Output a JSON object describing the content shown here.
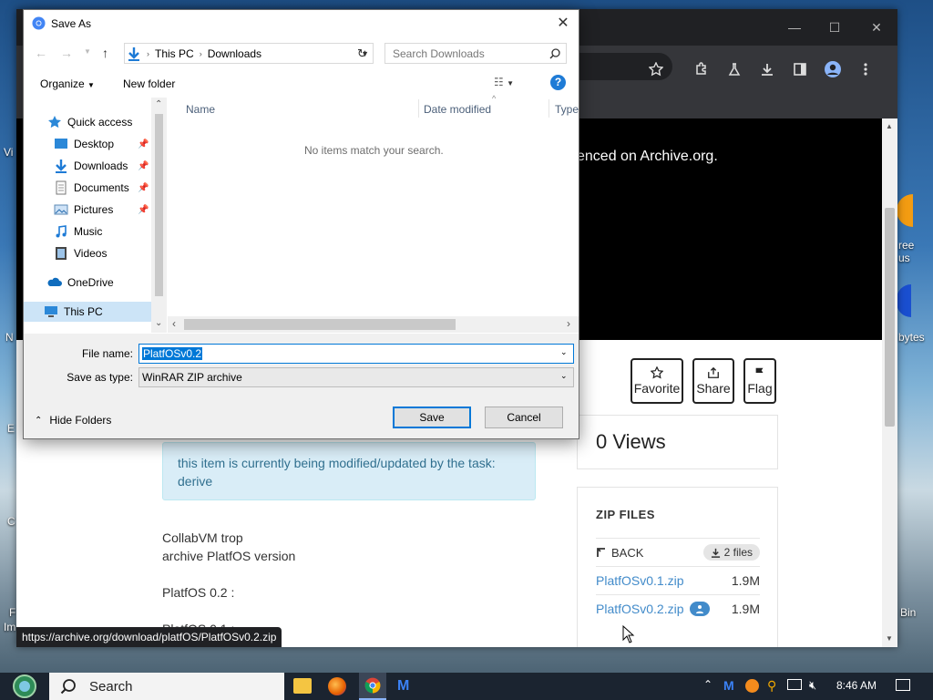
{
  "desktop": {
    "fragments": [
      "Vi",
      "ree",
      "us",
      "bytes",
      "N",
      "E",
      "C",
      "F",
      "Im",
      "Bin"
    ]
  },
  "browser": {
    "window_controls": {
      "minimize": "—",
      "maximize": "☐",
      "close": "✕"
    },
    "hero_text": "enced on Archive.org.",
    "actions": {
      "favorite": "Favorite",
      "share": "Share",
      "flag": "Flag"
    },
    "views": "0 Views",
    "notice": "this item is currently being modified/updated by the task: derive",
    "description": [
      "CollabVM trop",
      "archive PlatfOS version",
      "PlatfOS 0.2 :",
      "PlatfOS 0.1 :"
    ],
    "zip": {
      "title": "ZIP FILES",
      "back": "BACK",
      "files_badge": "2 files",
      "files": [
        {
          "name": "PlatfOSv0.1.zip",
          "size": "1.9M"
        },
        {
          "name": "PlatfOSv0.2.zip",
          "size": "1.9M"
        }
      ]
    },
    "status_url": "https://archive.org/download/platfOS/PlatfOSv0.2.zip"
  },
  "dialog": {
    "title": "Save As",
    "breadcrumb": [
      "This PC",
      "Downloads"
    ],
    "search_placeholder": "Search Downloads",
    "organize": "Organize",
    "new_folder": "New folder",
    "nav": {
      "quick_access": "Quick access",
      "desktop": "Desktop",
      "downloads": "Downloads",
      "documents": "Documents",
      "pictures": "Pictures",
      "music": "Music",
      "videos": "Videos",
      "onedrive": "OneDrive",
      "this_pc": "This PC"
    },
    "columns": {
      "name": "Name",
      "date_modified": "Date modified",
      "type": "Type"
    },
    "empty_message": "No items match your search.",
    "file_name_label": "File name:",
    "file_name_value": "PlatfOSv0.2",
    "save_type_label": "Save as type:",
    "save_type_value": "WinRAR ZIP archive",
    "hide_folders": "Hide Folders",
    "save_label": "Save",
    "cancel_label": "Cancel"
  },
  "taskbar": {
    "search_label": "Search",
    "time": "8:46 AM"
  }
}
